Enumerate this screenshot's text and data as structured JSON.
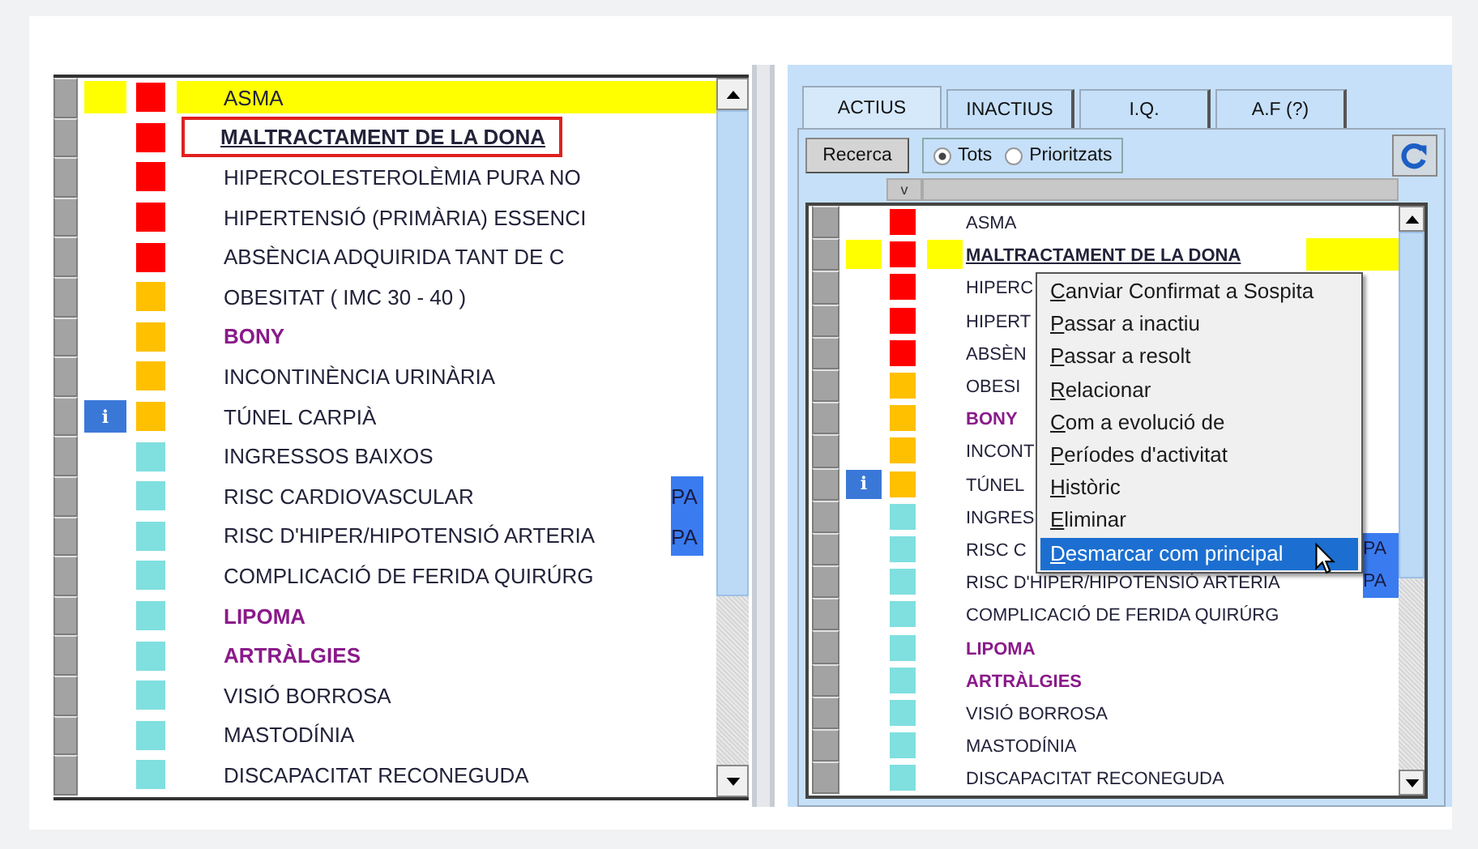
{
  "left_list": {
    "rows": [
      {
        "name": "ASMA",
        "color": "#ff0000",
        "kind": "normal",
        "selected": true,
        "principal": false,
        "outlined": false
      },
      {
        "name": "MALTRACTAMENT DE LA DONA",
        "color": "#ff0000",
        "kind": "normal",
        "selected": false,
        "principal": true,
        "outlined": true
      },
      {
        "name": "HIPERCOLESTEROLÈMIA PURA NO",
        "color": "#ff0000",
        "kind": "normal",
        "selected": false,
        "principal": false,
        "outlined": false
      },
      {
        "name": "HIPERTENSIÓ (PRIMÀRIA) ESSENCI",
        "color": "#ff0000",
        "kind": "normal",
        "selected": false,
        "principal": false,
        "outlined": false
      },
      {
        "name": "ABSÈNCIA ADQUIRIDA TANT DE C",
        "color": "#ff0000",
        "kind": "normal",
        "selected": false,
        "principal": false,
        "outlined": false
      },
      {
        "name": "OBESITAT ( IMC 30 - 40 )",
        "color": "#ffc000",
        "kind": "normal",
        "selected": false,
        "principal": false,
        "outlined": false
      },
      {
        "name": "BONY",
        "color": "#ffc000",
        "kind": "emphasis",
        "selected": false,
        "principal": false,
        "outlined": false
      },
      {
        "name": "INCONTINÈNCIA URINÀRIA",
        "color": "#ffc000",
        "kind": "normal",
        "selected": false,
        "principal": false,
        "outlined": false
      },
      {
        "name": "TÚNEL CARPIÀ",
        "color": "#ffc000",
        "kind": "normal",
        "selected": false,
        "principal": false,
        "outlined": false,
        "info": "i"
      },
      {
        "name": "INGRESSOS BAIXOS",
        "color": "#80dfdf",
        "kind": "normal",
        "selected": false,
        "principal": false,
        "outlined": false
      },
      {
        "name": "RISC CARDIOVASCULAR",
        "color": "#80dfdf",
        "kind": "normal",
        "selected": false,
        "principal": false,
        "outlined": false,
        "tag": "PA"
      },
      {
        "name": "RISC D'HIPER/HIPOTENSIÓ ARTERIA",
        "color": "#80dfdf",
        "kind": "normal",
        "selected": false,
        "principal": false,
        "outlined": false,
        "tag": "PA"
      },
      {
        "name": "COMPLICACIÓ DE FERIDA QUIRÚRG",
        "color": "#80dfdf",
        "kind": "normal",
        "selected": false,
        "principal": false,
        "outlined": false
      },
      {
        "name": "LIPOMA",
        "color": "#80dfdf",
        "kind": "emphasis",
        "selected": false,
        "principal": false,
        "outlined": false
      },
      {
        "name": "ARTRÀLGIES",
        "color": "#80dfdf",
        "kind": "emphasis",
        "selected": false,
        "principal": false,
        "outlined": false
      },
      {
        "name": "VISIÓ BORROSA",
        "color": "#80dfdf",
        "kind": "normal",
        "selected": false,
        "principal": false,
        "outlined": false
      },
      {
        "name": "MASTODÍNIA",
        "color": "#80dfdf",
        "kind": "normal",
        "selected": false,
        "principal": false,
        "outlined": false
      },
      {
        "name": "DISCAPACITAT RECONEGUDA",
        "color": "#80dfdf",
        "kind": "normal",
        "selected": false,
        "principal": false,
        "outlined": false
      }
    ]
  },
  "right_panel": {
    "tabs": [
      {
        "label": "ACTIUS",
        "selected": true
      },
      {
        "label": "INACTIUS",
        "selected": false
      },
      {
        "label": "I.Q.",
        "selected": false
      },
      {
        "label": "A.F (?)",
        "selected": false
      }
    ],
    "search_button": "Recerca",
    "filter": [
      {
        "label": "Tots",
        "selected": true
      },
      {
        "label": "Prioritzats",
        "selected": false
      }
    ],
    "column_header": "v",
    "rows": [
      {
        "name": "ASMA",
        "color": "#ff0000",
        "kind": "normal",
        "selected": false,
        "principal": false
      },
      {
        "name": "MALTRACTAMENT DE LA DONA",
        "color": "#ff0000",
        "kind": "normal",
        "selected": true,
        "principal": true
      },
      {
        "name": "HIPERC",
        "color": "#ff0000",
        "kind": "normal",
        "selected": false,
        "principal": false
      },
      {
        "name": "HIPERT",
        "color": "#ff0000",
        "kind": "normal",
        "selected": false,
        "principal": false
      },
      {
        "name": "ABSÈN",
        "color": "#ff0000",
        "kind": "normal",
        "selected": false,
        "principal": false
      },
      {
        "name": "OBESI",
        "color": "#ffc000",
        "kind": "normal",
        "selected": false,
        "principal": false
      },
      {
        "name": "BONY",
        "color": "#ffc000",
        "kind": "emphasis",
        "selected": false,
        "principal": false
      },
      {
        "name": "INCONT",
        "color": "#ffc000",
        "kind": "normal",
        "selected": false,
        "principal": false
      },
      {
        "name": "TÚNEL",
        "color": "#ffc000",
        "kind": "normal",
        "selected": false,
        "principal": false,
        "info": "i"
      },
      {
        "name": "INGRES",
        "color": "#80dfdf",
        "kind": "normal",
        "selected": false,
        "principal": false
      },
      {
        "name": "RISC C",
        "color": "#80dfdf",
        "kind": "normal",
        "selected": false,
        "principal": false,
        "tag": "PA"
      },
      {
        "name": "RISC D'HIPER/HIPOTENSIÓ ARTERIA",
        "color": "#80dfdf",
        "kind": "normal",
        "selected": false,
        "principal": false,
        "tag": "PA"
      },
      {
        "name": "COMPLICACIÓ DE FERIDA QUIRÚRG",
        "color": "#80dfdf",
        "kind": "normal",
        "selected": false,
        "principal": false
      },
      {
        "name": "LIPOMA",
        "color": "#80dfdf",
        "kind": "emphasis",
        "selected": false,
        "principal": false
      },
      {
        "name": "ARTRÀLGIES",
        "color": "#80dfdf",
        "kind": "emphasis",
        "selected": false,
        "principal": false
      },
      {
        "name": "VISIÓ BORROSA",
        "color": "#80dfdf",
        "kind": "normal",
        "selected": false,
        "principal": false
      },
      {
        "name": "MASTODÍNIA",
        "color": "#80dfdf",
        "kind": "normal",
        "selected": false,
        "principal": false
      },
      {
        "name": "DISCAPACITAT RECONEGUDA",
        "color": "#80dfdf",
        "kind": "normal",
        "selected": false,
        "principal": false
      }
    ],
    "context_menu": {
      "items": [
        {
          "label": "Canviar Confirmat a Sospita",
          "selected": false
        },
        {
          "label": "Passar a inactiu",
          "selected": false
        },
        {
          "label": "Passar a resolt",
          "selected": false
        },
        {
          "label": "Relacionar",
          "selected": false
        },
        {
          "label": "Com a evolució de",
          "selected": false
        },
        {
          "label": "Períodes d'activitat",
          "selected": false
        },
        {
          "label": "Històric",
          "selected": false
        },
        {
          "label": "Eliminar",
          "selected": false
        },
        {
          "label": "Desmarcar com principal",
          "selected": true
        }
      ]
    }
  }
}
